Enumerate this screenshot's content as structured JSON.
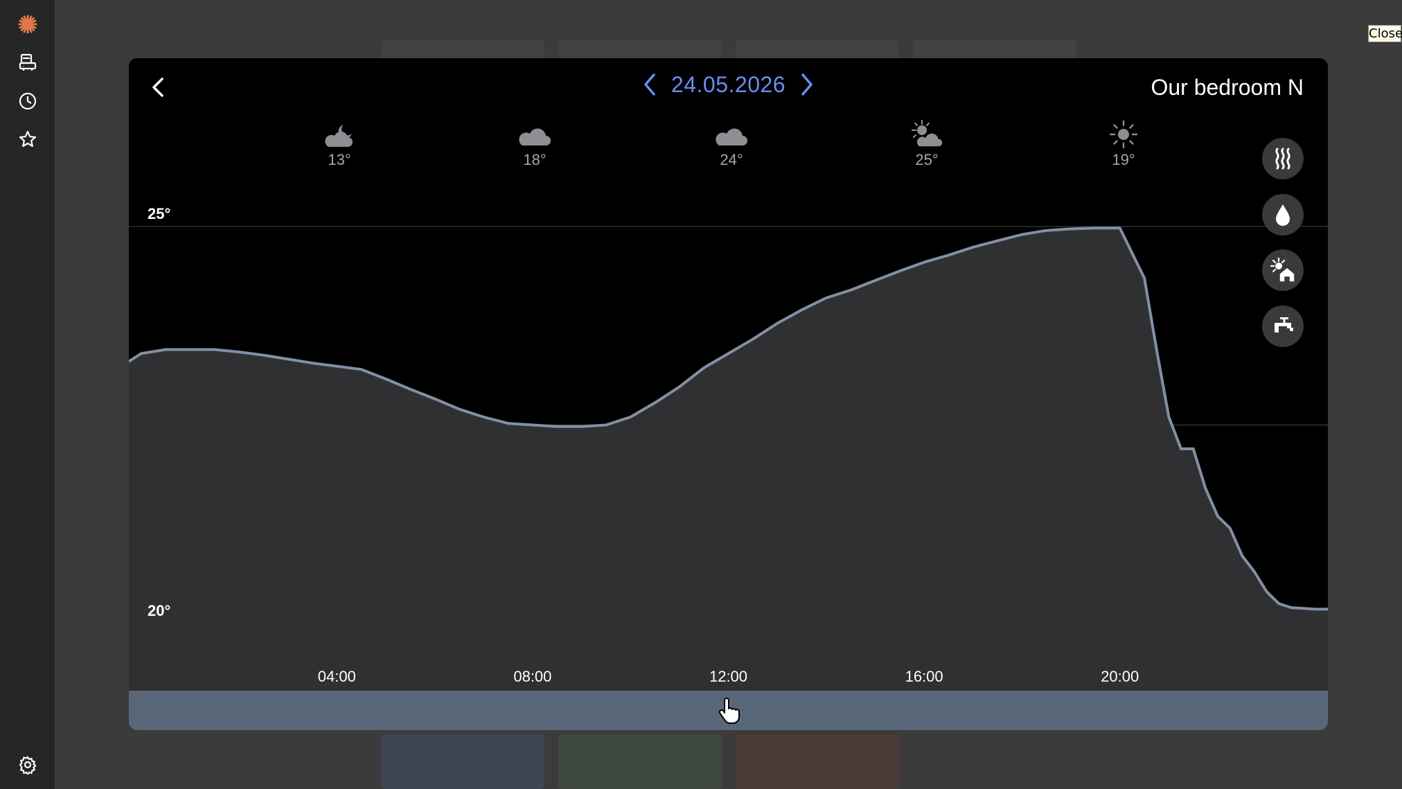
{
  "sidebar": {
    "items": [
      {
        "icon": "sun-logo-icon"
      },
      {
        "icon": "devices-icon"
      },
      {
        "icon": "clock-icon"
      },
      {
        "icon": "star-icon"
      },
      {
        "icon": "gear-icon"
      }
    ]
  },
  "close_label": "Close",
  "header": {
    "date": "24.05.2026",
    "room": "Our bedroom N"
  },
  "weather": [
    {
      "time": "04:00",
      "icon": "moon-cloud-icon",
      "temp": "13°"
    },
    {
      "time": "08:00",
      "icon": "cloud-icon",
      "temp": "18°"
    },
    {
      "time": "12:00",
      "icon": "cloud-icon",
      "temp": "24°"
    },
    {
      "time": "16:00",
      "icon": "sun-cloud-icon",
      "temp": "25°"
    },
    {
      "time": "20:00",
      "icon": "sun-icon",
      "temp": "19°"
    }
  ],
  "modes": [
    "heating-icon",
    "humidity-icon",
    "outdoor-sun-home-icon",
    "water-tap-icon"
  ],
  "colors": {
    "accent": "#6b8df2",
    "line": "#8290a4",
    "fill": "#303032",
    "bar": "#5a6779"
  },
  "chart_data": {
    "type": "area",
    "y_tick_labels": [
      "25°",
      "20°"
    ],
    "y_ticks": [
      25,
      20
    ],
    "ylim": [
      19.6,
      25.55
    ],
    "x_tick_labels": [
      "04:00",
      "08:00",
      "12:00",
      "16:00",
      "20:00"
    ],
    "x_ticks": [
      4,
      8,
      12,
      16,
      20
    ],
    "xlim": [
      -0.25,
      24.25
    ],
    "series": [
      {
        "x": [
          -0.25,
          0.0,
          0.5,
          1.0,
          1.25,
          1.5,
          2.0,
          2.5,
          3.0,
          3.5,
          4.0,
          4.5,
          5.0,
          5.5,
          6.0,
          6.5,
          7.0,
          7.5,
          8.0,
          8.5,
          9.0,
          9.5,
          10.0,
          10.5,
          11.0,
          11.5,
          12.0,
          12.5,
          13.0,
          13.5,
          14.0,
          14.5,
          15.0,
          15.5,
          16.0,
          16.5,
          17.0,
          17.5,
          18.0,
          18.5,
          19.0,
          19.5,
          20.0,
          20.5,
          20.75,
          21.0,
          21.25,
          21.5,
          21.75,
          22.0,
          22.25,
          22.5,
          22.75,
          23.0,
          23.25,
          23.5,
          23.75,
          24.0,
          24.25
        ],
        "values": [
          23.3,
          23.4,
          23.45,
          23.45,
          23.45,
          23.45,
          23.42,
          23.38,
          23.33,
          23.28,
          23.24,
          23.2,
          23.08,
          22.95,
          22.83,
          22.7,
          22.6,
          22.52,
          22.5,
          22.48,
          22.48,
          22.5,
          22.6,
          22.78,
          22.98,
          23.22,
          23.4,
          23.58,
          23.78,
          23.95,
          24.1,
          24.2,
          24.32,
          24.44,
          24.55,
          24.64,
          24.74,
          24.82,
          24.9,
          24.95,
          24.97,
          24.98,
          24.98,
          24.35,
          23.45,
          22.6,
          22.2,
          22.2,
          21.7,
          21.35,
          21.2,
          20.85,
          20.65,
          20.4,
          20.25,
          20.2,
          20.19,
          20.18,
          20.18
        ]
      }
    ]
  }
}
